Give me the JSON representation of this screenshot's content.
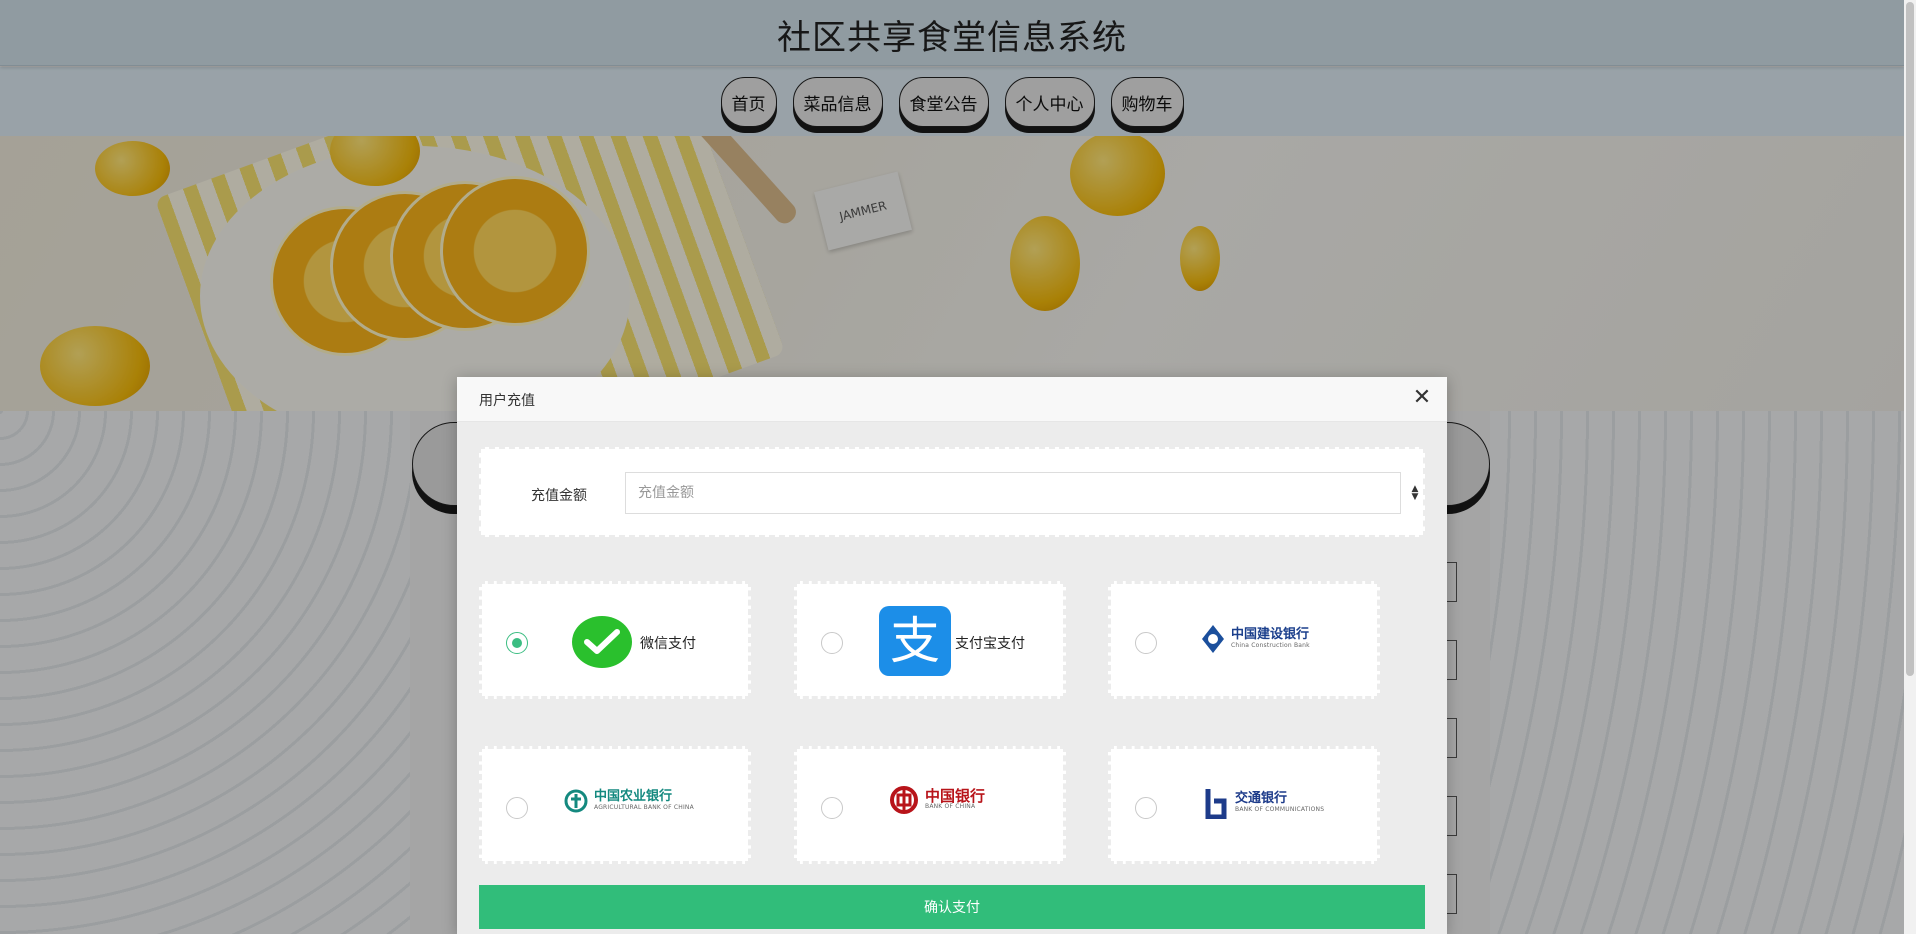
{
  "site": {
    "title": "社区共享食堂信息系统"
  },
  "nav": {
    "items": [
      "首页",
      "菜品信息",
      "食堂公告",
      "个人中心",
      "购物车"
    ]
  },
  "banner": {
    "tag_text": "JAMMER"
  },
  "modal": {
    "title": "用户充值",
    "close_symbol": "✕",
    "amount": {
      "label": "充值金额",
      "placeholder": "充值金额",
      "value": ""
    },
    "payment_methods": [
      {
        "label": "微信支付",
        "selected": true,
        "icon": "wechat-pay-icon"
      },
      {
        "label": "支付宝支付",
        "selected": false,
        "icon": "alipay-icon",
        "glyph": "支"
      },
      {
        "name": "中国建设银行",
        "sub": "China Construction Bank",
        "selected": false,
        "icon": "ccb-logo"
      },
      {
        "name": "中国农业银行",
        "sub": "AGRICULTURAL BANK OF CHINA",
        "selected": false,
        "icon": "abc-logo"
      },
      {
        "name": "中国银行",
        "sub": "BANK OF CHINA",
        "selected": false,
        "icon": "boc-logo"
      },
      {
        "name": "交通银行",
        "sub": "BANK OF COMMUNICATIONS",
        "selected": false,
        "icon": "bocom-logo"
      }
    ],
    "confirm_label": "确认支付"
  },
  "colors": {
    "accent": "#31bd7a",
    "header_bg": "#cfdfe7",
    "nav_bg": "#dbe9f1"
  }
}
